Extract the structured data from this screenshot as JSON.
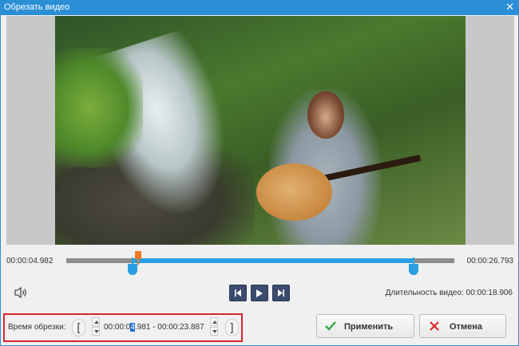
{
  "window": {
    "title": "Обрезать видео",
    "close_glyph": "✕"
  },
  "timeline": {
    "start_time": "00:00:04.982",
    "end_time": "00:00:26.793",
    "selection_start_fraction": 0.17,
    "selection_end_fraction": 0.895,
    "playhead_fraction": 0.185
  },
  "playback": {
    "prev_icon": "skip-to-start-icon",
    "play_icon": "play-icon",
    "next_icon": "skip-to-end-icon",
    "volume_icon": "speaker-icon"
  },
  "duration": {
    "label": "Длительность видео:",
    "value": "00:00:18.906"
  },
  "trim": {
    "label": "Время обрезки:",
    "start_bracket": "[",
    "end_bracket": "]",
    "time_before_cursor": "00:00:0",
    "time_cursor": "4",
    "time_after_cursor": ".981 - 00:00:23.887"
  },
  "buttons": {
    "apply_label": "Применить",
    "cancel_label": "Отмена"
  },
  "colors": {
    "titlebar": "#2b8fd6",
    "accent": "#2a9fe3",
    "playhead": "#f07a24",
    "highlight_border": "#d8262c",
    "apply_check": "#2eaa3c",
    "cancel_x": "#d8262c"
  }
}
